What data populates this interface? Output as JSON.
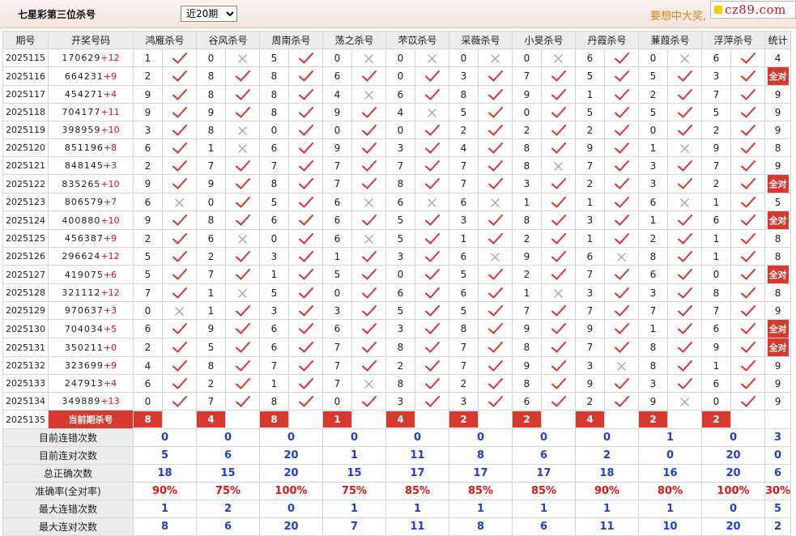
{
  "header": {
    "title": "七星彩第三位杀号",
    "period_selected": "近20期",
    "period_options": [
      "近20期"
    ],
    "promo": "要想中大奖,",
    "logo_text": "cz89.com"
  },
  "columns": {
    "period": "期号",
    "numbers": "开奖号码",
    "experts": [
      "鸿雁杀号",
      "谷风杀号",
      "周南杀号",
      "荡之杀号",
      "芣苡杀号",
      "采薇杀号",
      "小旻杀号",
      "丹霞杀号",
      "蒹葭杀号",
      "浮萍杀号"
    ],
    "stats": "统计"
  },
  "rows": [
    {
      "period": "2025115",
      "digits": "170629",
      "sum": "+12",
      "preds": [
        1,
        0,
        5,
        0,
        0,
        0,
        0,
        6,
        0,
        6
      ],
      "ok": [
        1,
        0,
        1,
        0,
        0,
        0,
        0,
        1,
        0,
        1
      ],
      "stat": "4"
    },
    {
      "period": "2025116",
      "digits": "664231",
      "sum": "+9",
      "preds": [
        2,
        8,
        8,
        6,
        0,
        3,
        7,
        5,
        5,
        3
      ],
      "ok": [
        1,
        1,
        1,
        1,
        1,
        1,
        1,
        1,
        1,
        1
      ],
      "stat": "全对"
    },
    {
      "period": "2025117",
      "digits": "454271",
      "sum": "+4",
      "preds": [
        9,
        8,
        8,
        4,
        6,
        8,
        9,
        1,
        2,
        7
      ],
      "ok": [
        1,
        1,
        1,
        0,
        1,
        1,
        1,
        1,
        1,
        1
      ],
      "stat": "9"
    },
    {
      "period": "2025118",
      "digits": "704177",
      "sum": "+11",
      "preds": [
        9,
        9,
        8,
        9,
        4,
        5,
        0,
        5,
        5,
        5
      ],
      "ok": [
        1,
        1,
        1,
        1,
        0,
        1,
        1,
        1,
        1,
        1
      ],
      "stat": "9"
    },
    {
      "period": "2025119",
      "digits": "398959",
      "sum": "+10",
      "preds": [
        3,
        8,
        0,
        0,
        0,
        2,
        2,
        2,
        0,
        2
      ],
      "ok": [
        1,
        0,
        1,
        1,
        1,
        1,
        1,
        1,
        1,
        1
      ],
      "stat": "9"
    },
    {
      "period": "2025120",
      "digits": "851196",
      "sum": "+8",
      "preds": [
        6,
        1,
        6,
        9,
        3,
        4,
        8,
        9,
        1,
        9
      ],
      "ok": [
        1,
        0,
        1,
        1,
        1,
        1,
        1,
        1,
        0,
        1
      ],
      "stat": "8"
    },
    {
      "period": "2025121",
      "digits": "848145",
      "sum": "+3",
      "preds": [
        2,
        7,
        7,
        7,
        7,
        7,
        8,
        7,
        3,
        7
      ],
      "ok": [
        1,
        1,
        1,
        1,
        1,
        1,
        0,
        1,
        1,
        1
      ],
      "stat": "9"
    },
    {
      "period": "2025122",
      "digits": "835265",
      "sum": "+10",
      "preds": [
        9,
        9,
        8,
        7,
        8,
        7,
        3,
        2,
        3,
        2
      ],
      "ok": [
        1,
        1,
        1,
        1,
        1,
        1,
        1,
        1,
        1,
        1
      ],
      "stat": "全对"
    },
    {
      "period": "2025123",
      "digits": "806579",
      "sum": "+7",
      "preds": [
        6,
        0,
        5,
        6,
        6,
        6,
        1,
        1,
        6,
        1
      ],
      "ok": [
        0,
        1,
        1,
        0,
        0,
        0,
        1,
        1,
        0,
        1
      ],
      "stat": "5"
    },
    {
      "period": "2025124",
      "digits": "400880",
      "sum": "+10",
      "preds": [
        9,
        8,
        6,
        6,
        5,
        3,
        8,
        3,
        1,
        6
      ],
      "ok": [
        1,
        1,
        1,
        1,
        1,
        1,
        1,
        1,
        1,
        1
      ],
      "stat": "全对"
    },
    {
      "period": "2025125",
      "digits": "456387",
      "sum": "+9",
      "preds": [
        2,
        6,
        0,
        6,
        5,
        1,
        2,
        1,
        2,
        1
      ],
      "ok": [
        1,
        0,
        1,
        0,
        1,
        1,
        1,
        1,
        1,
        1
      ],
      "stat": "8"
    },
    {
      "period": "2025126",
      "digits": "296624",
      "sum": "+12",
      "preds": [
        5,
        2,
        3,
        1,
        3,
        6,
        9,
        6,
        8,
        1
      ],
      "ok": [
        1,
        1,
        1,
        1,
        1,
        0,
        1,
        0,
        1,
        1
      ],
      "stat": "8"
    },
    {
      "period": "2025127",
      "digits": "419075",
      "sum": "+6",
      "preds": [
        5,
        7,
        1,
        5,
        0,
        5,
        2,
        7,
        6,
        0
      ],
      "ok": [
        1,
        1,
        1,
        1,
        1,
        1,
        1,
        1,
        1,
        1
      ],
      "stat": "全对"
    },
    {
      "period": "2025128",
      "digits": "321112",
      "sum": "+12",
      "preds": [
        7,
        1,
        5,
        0,
        6,
        6,
        1,
        3,
        3,
        8
      ],
      "ok": [
        1,
        0,
        1,
        1,
        1,
        1,
        0,
        1,
        1,
        1
      ],
      "stat": "8"
    },
    {
      "period": "2025129",
      "digits": "970637",
      "sum": "+3",
      "preds": [
        0,
        1,
        3,
        3,
        5,
        5,
        7,
        7,
        7,
        7
      ],
      "ok": [
        0,
        1,
        1,
        1,
        1,
        1,
        1,
        1,
        1,
        1
      ],
      "stat": "9"
    },
    {
      "period": "2025130",
      "digits": "704034",
      "sum": "+5",
      "preds": [
        6,
        9,
        6,
        6,
        3,
        8,
        9,
        9,
        1,
        6
      ],
      "ok": [
        1,
        1,
        1,
        1,
        1,
        1,
        1,
        1,
        1,
        1
      ],
      "stat": "全对"
    },
    {
      "period": "2025131",
      "digits": "350211",
      "sum": "+0",
      "preds": [
        2,
        5,
        6,
        7,
        8,
        7,
        8,
        7,
        8,
        9
      ],
      "ok": [
        1,
        1,
        1,
        1,
        1,
        1,
        1,
        1,
        1,
        1
      ],
      "stat": "全对"
    },
    {
      "period": "2025132",
      "digits": "323699",
      "sum": "+9",
      "preds": [
        4,
        8,
        7,
        7,
        2,
        7,
        9,
        3,
        8,
        1
      ],
      "ok": [
        1,
        1,
        1,
        1,
        1,
        1,
        1,
        0,
        1,
        1
      ],
      "stat": "9"
    },
    {
      "period": "2025133",
      "digits": "247913",
      "sum": "+4",
      "preds": [
        6,
        2,
        1,
        7,
        8,
        2,
        8,
        9,
        3,
        6
      ],
      "ok": [
        1,
        1,
        1,
        0,
        1,
        1,
        1,
        1,
        1,
        1
      ],
      "stat": "9"
    },
    {
      "period": "2025134",
      "digits": "349889",
      "sum": "+13",
      "preds": [
        0,
        7,
        8,
        0,
        3,
        3,
        6,
        2,
        9,
        0
      ],
      "ok": [
        1,
        1,
        1,
        1,
        1,
        1,
        1,
        1,
        0,
        1
      ],
      "stat": "9"
    }
  ],
  "current": {
    "period": "2025135",
    "label": "当前期杀号",
    "preds": [
      8,
      4,
      8,
      1,
      4,
      2,
      2,
      4,
      2,
      2
    ]
  },
  "summary": [
    {
      "label": "目前连错次数",
      "values": [
        "0",
        "0",
        "0",
        "0",
        "0",
        "0",
        "0",
        "0",
        "1",
        "0"
      ],
      "stat": "3"
    },
    {
      "label": "目前连对次数",
      "values": [
        "5",
        "6",
        "20",
        "1",
        "11",
        "8",
        "6",
        "2",
        "0",
        "20"
      ],
      "stat": "0"
    },
    {
      "label": "总正确次数",
      "values": [
        "18",
        "15",
        "20",
        "15",
        "17",
        "17",
        "17",
        "18",
        "16",
        "20"
      ],
      "stat": "6"
    },
    {
      "label": "准确率(全对率)",
      "values": [
        "90%",
        "75%",
        "100%",
        "75%",
        "85%",
        "85%",
        "85%",
        "90%",
        "80%",
        "100%"
      ],
      "stat": "30%",
      "highlight": true
    },
    {
      "label": "最大连错次数",
      "values": [
        "1",
        "2",
        "0",
        "1",
        "1",
        "1",
        "1",
        "1",
        "1",
        "0"
      ],
      "stat": "5"
    },
    {
      "label": "最大连对次数",
      "values": [
        "8",
        "6",
        "20",
        "7",
        "11",
        "8",
        "6",
        "11",
        "10",
        "20"
      ],
      "stat": "2"
    }
  ],
  "colors": {
    "check": "#e0302a",
    "cross": "#9a9a9a",
    "badge": "#d63a2f",
    "stat_blue": "#1d3fd6",
    "stat_red": "#e21414"
  }
}
